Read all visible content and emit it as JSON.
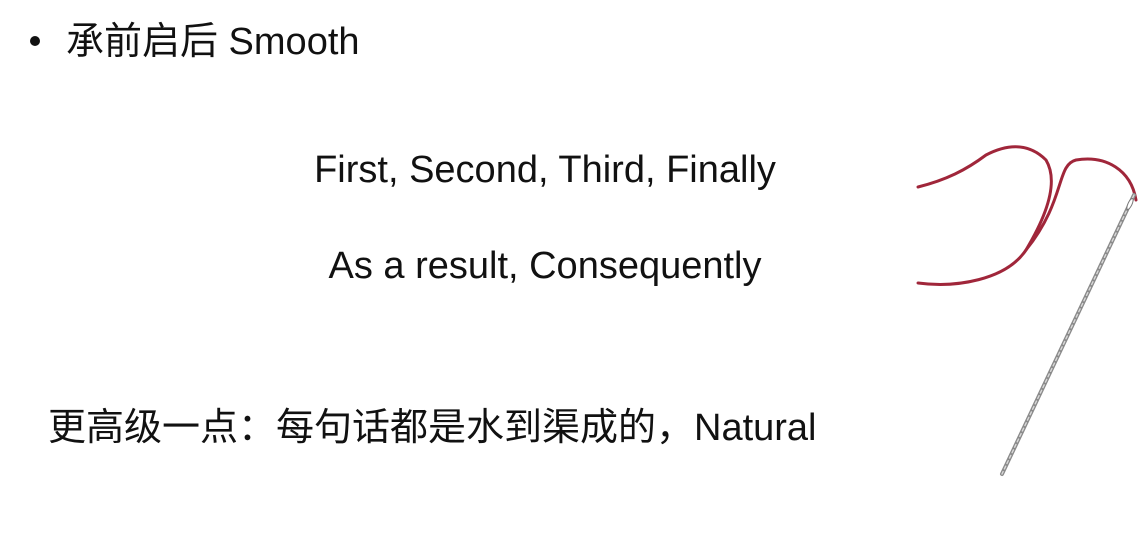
{
  "slide": {
    "bullet_text": "承前启后 Smooth",
    "transition_examples": [
      "First, Second, Third, Finally",
      "As a result, Consequently"
    ],
    "advanced_text": "更高级一点：每句话都是水到渠成的，Natural"
  },
  "illustration": {
    "icon": "needle-and-thread-icon",
    "thread_color": "#a0263a",
    "needle_color": "#8a8a8a"
  }
}
